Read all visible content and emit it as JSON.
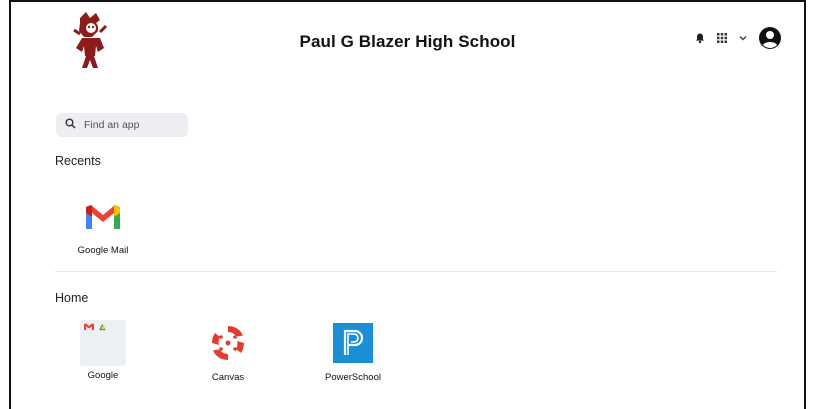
{
  "header": {
    "title": "Paul G Blazer High School",
    "icons": [
      "bell-icon",
      "apps-grid-icon",
      "chevron-down-icon",
      "account-icon"
    ]
  },
  "search": {
    "placeholder": "Find an app"
  },
  "recents": {
    "label": "Recents",
    "apps": [
      {
        "name": "Google Mail",
        "icon": "gmail-icon"
      }
    ]
  },
  "home": {
    "label": "Home",
    "apps": [
      {
        "name": "Google",
        "icon": "google-folder-icon"
      },
      {
        "name": "Canvas",
        "icon": "canvas-icon"
      },
      {
        "name": "PowerSchool",
        "icon": "powerschool-icon"
      }
    ]
  },
  "colors": {
    "canvas_red": "#e13d2e",
    "powerschool_blue": "#1a8fd6",
    "divider": "#e6e6e6"
  }
}
